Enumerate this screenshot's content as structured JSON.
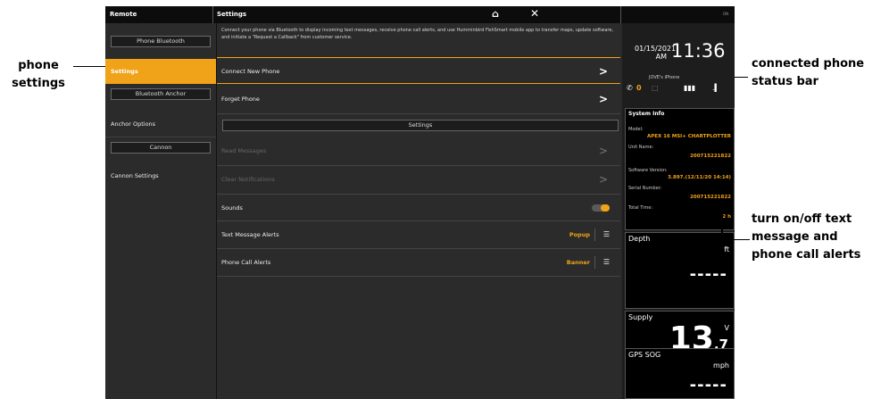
{
  "topbar": {
    "left_title": "Remote",
    "mid_title": "Settings",
    "home_icon": "⌂",
    "close_icon": "✕",
    "battery_text": "ON"
  },
  "left_panel": {
    "phone_bluetooth": "Phone Bluetooth",
    "settings": "Settings",
    "bluetooth_anchor": "Bluetooth Anchor",
    "anchor_options": "Anchor Options",
    "cannon": "Cannon",
    "cannon_settings": "Cannon Settings"
  },
  "main": {
    "description": "Connect your phone via Bluetooth to display incoming text messages, receive phone call alerts, and use Humminbird FishSmart mobile app to transfer maps, update software, and initiate a \"Request a Callback\" from customer service.",
    "connect_new_phone": "Connect New Phone",
    "forget_phone": "Forget Phone",
    "settings_header": "Settings",
    "read_messages": "Read Messages",
    "clear_notifications": "Clear Notifications",
    "sounds": "Sounds",
    "text_message_alerts": "Text Message Alerts",
    "text_message_value": "Popup",
    "phone_call_alerts": "Phone Call Alerts",
    "phone_call_value": "Banner",
    "toggle_label": "on"
  },
  "right_panel": {
    "date_line1": "01/15/2021",
    "date_line2": "AM",
    "time": "11:36",
    "phone_name": "JOVE's iPhone",
    "call_count": "0",
    "system_info": {
      "title": "System Info",
      "model_label": "Model:",
      "model": "APEX 16 MSI+ CHARTPLOTTER",
      "unit_label": "Unit Name:",
      "unit": "200715221822",
      "sw_label": "Software Version:",
      "sw": "3.897.(12/11/20 14:14)",
      "serial_label": "Serial Number:",
      "serial": "200715221822",
      "total_label": "Total Time:",
      "total": "2 h"
    },
    "depth": {
      "title": "Depth",
      "unit": "ft",
      "value": "-----"
    },
    "supply": {
      "title": "Supply",
      "unit": "V",
      "value_int": "13",
      "value_dec": ".7"
    },
    "gps": {
      "title": "GPS SOG",
      "unit": "mph",
      "value": "-----"
    }
  },
  "annotations": {
    "phone_settings_1": "phone",
    "phone_settings_2": "settings",
    "connected_1": "connected phone",
    "connected_2": "status bar",
    "alerts_1": "turn on/off text",
    "alerts_2": "message and",
    "alerts_3": "phone call alerts"
  },
  "colors": {
    "accent": "#f0a219",
    "background": "#2b2b2b",
    "panel": "#000000"
  }
}
